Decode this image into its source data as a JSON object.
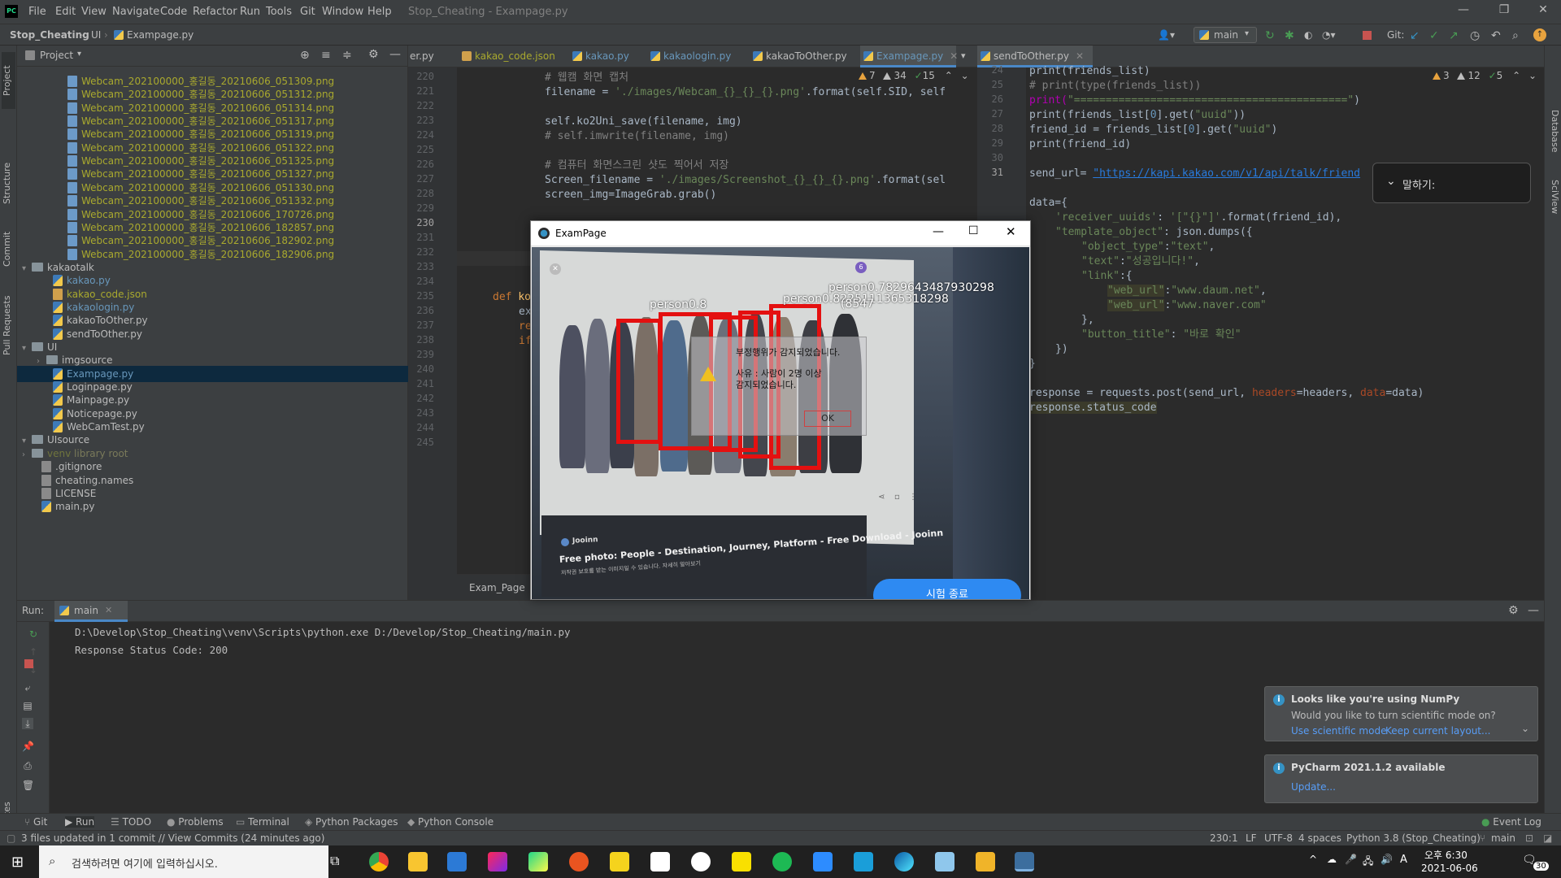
{
  "menubar": {
    "logo": "PC",
    "items": [
      "File",
      "Edit",
      "View",
      "Navigate",
      "Code",
      "Refactor",
      "Run",
      "Tools",
      "Git",
      "Window",
      "Help"
    ],
    "window_title": "Stop_Cheating - Exampage.py"
  },
  "navbar": {
    "crumbs": [
      "Stop_Cheating",
      "UI",
      "Exampage.py"
    ],
    "branch": "main",
    "git_label": "Git:"
  },
  "left_stripe": [
    "Project",
    "Structure",
    "Commit",
    "Pull Requests",
    "Favorites"
  ],
  "right_stripe": [
    "Database",
    "SciView"
  ],
  "project_panel": {
    "title": "Project",
    "files_top": [
      "Webcam_202100000_홍길동_20210606_051309.png",
      "Webcam_202100000_홍길동_20210606_051312.png",
      "Webcam_202100000_홍길동_20210606_051314.png",
      "Webcam_202100000_홍길동_20210606_051317.png",
      "Webcam_202100000_홍길동_20210606_051319.png",
      "Webcam_202100000_홍길동_20210606_051322.png",
      "Webcam_202100000_홍길동_20210606_051325.png",
      "Webcam_202100000_홍길동_20210606_051327.png",
      "Webcam_202100000_홍길동_20210606_051330.png",
      "Webcam_202100000_홍길동_20210606_051332.png",
      "Webcam_202100000_홍길동_20210606_170726.png",
      "Webcam_202100000_홍길동_20210606_182857.png",
      "Webcam_202100000_홍길동_20210606_182902.png",
      "Webcam_202100000_홍길동_20210606_182906.png"
    ],
    "kakaotalk": "kakaotalk",
    "kakao_files": [
      "kakao.py",
      "kakao_code.json",
      "kakaologin.py",
      "kakaoToOther.py",
      "sendToOther.py"
    ],
    "ui": "UI",
    "imgsource": "imgsource",
    "ui_files": [
      "Exampage.py",
      "Loginpage.py",
      "Mainpage.py",
      "Noticepage.py",
      "WebCamTest.py"
    ],
    "uisource": "UIsource",
    "venv": "venv",
    "venv_note": "library root",
    "root_files": [
      ".gitignore",
      "cheating.names",
      "LICENSE",
      "main.py"
    ]
  },
  "tabs_left": [
    {
      "label": "er.py"
    },
    {
      "label": "kakao_code.json"
    },
    {
      "label": "kakao.py"
    },
    {
      "label": "kakaologin.py"
    },
    {
      "label": "kakaoToOther.py"
    },
    {
      "label": "Exampage.py"
    }
  ],
  "tabs_right": [
    {
      "label": "sendToOther.py"
    }
  ],
  "editor_left": {
    "lines": [
      "220",
      "221",
      "222",
      "223",
      "224",
      "225",
      "226",
      "227",
      "228",
      "229",
      "230",
      "231",
      "232",
      "233",
      "234",
      "235",
      "236",
      "237",
      "238",
      "239",
      "240",
      "241",
      "242",
      "243",
      "244",
      "245"
    ],
    "warnings": {
      "w": "7",
      "c": "34",
      "ok": "15"
    },
    "breadcrumb": "Exam_Page",
    "code": {
      "l220": "# 웹캠 화면 캡처",
      "l221a": "filename = ",
      "l221b": "'./images/Webcam_{}_{}_{}.png'",
      "l221c": ".format(self.SID, self",
      "l223": "self.ko2Uni_save(filename, img)",
      "l224": "# self.imwrite(filename, img)",
      "l226": "# 컴퓨터 화면스크린 샷도 찍어서 저장",
      "l227a": "Screen_filename = ",
      "l227b": "'./images/Screenshot_{}_{}_{}.png'",
      "l227c": ".format(sel",
      "l228": "screen_img=ImageGrab.grab()",
      "l235a": "def ",
      "l235b": "ko",
      "l236": "ex",
      "l237": "re",
      "l238": "if"
    }
  },
  "editor_right": {
    "lines": [
      "24",
      "25",
      "26",
      "27",
      "28",
      "29",
      "30",
      "31"
    ],
    "warnings": {
      "w": "3",
      "c": "12",
      "ok": "5"
    },
    "code": {
      "l24": "print(friends_list)",
      "l25": "# print(type(friends_list))",
      "l26a": "print(",
      "l26b": "\"===========================================\"",
      "l26c": ")",
      "l27a": "print(friends_list[",
      "l27b": "0",
      "l27c": "].get(",
      "l27d": "\"uuid\"",
      "l27e": "))",
      "l28a": "friend_id = friends_list[",
      "l28b": "0",
      "l28c": "].get(",
      "l28d": "\"uuid\"",
      "l28e": ")",
      "l29": "print(friend_id)",
      "l31a": "send_url= ",
      "l31b": "\"https://kapi.kakao.com/v1/api/talk/friend",
      "l33": "data={",
      "l34a": "'receiver_uuids'",
      "l34b": ": ",
      "l34c": "'[\"{}\"]'",
      "l34d": ".format(friend_id),",
      "l35a": "\"template_object\"",
      "l35b": ": json.dumps({",
      "l36a": "\"object_type\"",
      "l36b": ":",
      "l36c": "\"text\"",
      "l37a": "\"text\"",
      "l37b": ":",
      "l37c": "\"성공입니다!\"",
      "l38a": "\"link\"",
      "l38b": ":{",
      "l39a": "\"web_url\"",
      "l39b": ":",
      "l39c": "\"www.daum.net\"",
      "l40a": "\"web_url\"",
      "l40b": ":",
      "l40c": "\"www.naver.com\"",
      "l41": "},",
      "l42a": "\"button_title\"",
      "l42b": ": ",
      "l42c": "\"바로 확인\"",
      "l43": "})",
      "l44": "}",
      "l46a": "response = requests.post(send_url, ",
      "l46b": "headers",
      "l46c": "=headers, ",
      "l46d": "data",
      "l46e": "=data)",
      "l47": "response.status_code"
    }
  },
  "speak_popup": "말하기:",
  "exam_window": {
    "title": "ExamPage",
    "detections": [
      "person0.7829643487930298",
      "person0.8225111365318298",
      "person0.8",
      "(8547"
    ],
    "alert_line1": "부정행위가 감지되었습니다.",
    "alert_line2": "사유 : 사람이 2명 이상",
    "alert_line3": "감지되었습니다.",
    "alert_ok": "OK",
    "caption": "Free photo: People - Destination, Journey, Platform - Free Download - Jooinn",
    "caption_sub": "저작권 보호를 받는 이미지일 수 있습니다. 자세히 알아보기",
    "site": "Jooinn",
    "end_button": "시험 종료"
  },
  "run_panel": {
    "label": "Run:",
    "config": "main",
    "cmd": "D:\\Develop\\Stop_Cheating\\venv\\Scripts\\python.exe D:/Develop/Stop_Cheating/main.py",
    "output": "Response Status Code: 200"
  },
  "notifications": [
    {
      "title": "Looks like you're using NumPy",
      "body": "Would you like to turn scientific mode on?",
      "link1": "Use scientific mode",
      "link2": "Keep current layout..."
    },
    {
      "title": "PyCharm 2021.1.2 available",
      "link1": "Update..."
    }
  ],
  "bottom_tabs": [
    "Git",
    "Run",
    "TODO",
    "Problems",
    "Terminal",
    "Python Packages",
    "Python Console",
    "Event Log"
  ],
  "statusbar": {
    "message": "3 files updated in 1 commit // View Commits (24 minutes ago)",
    "pos": "230:1",
    "lf": "LF",
    "enc": "UTF-8",
    "indent": "4 spaces",
    "interp": "Python 3.8 (Stop_Cheating)",
    "branch": "main"
  },
  "taskbar": {
    "search_placeholder": "검색하려면 여기에 입력하십시오.",
    "time": "오후 6:30",
    "date": "2021-06-06",
    "ime": "A",
    "notif_count": "30"
  }
}
